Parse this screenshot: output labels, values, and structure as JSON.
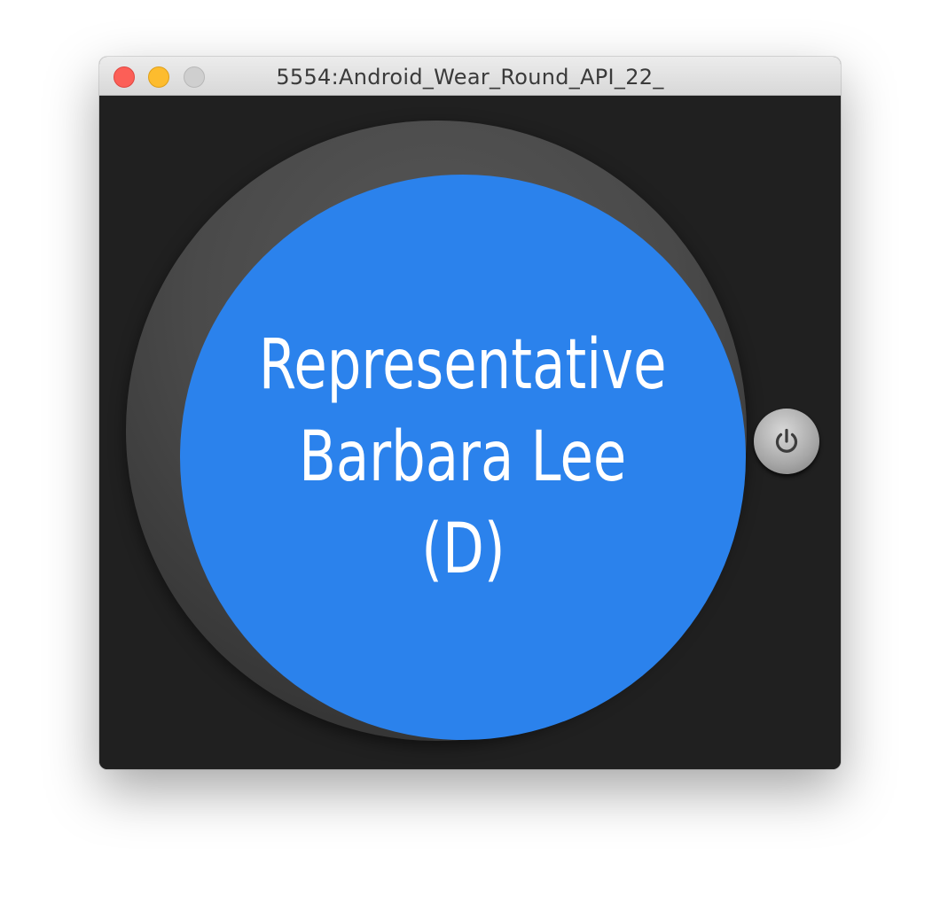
{
  "window": {
    "title": "5554:Android_Wear_Round_API_22_"
  },
  "watch": {
    "lines": [
      "Representative",
      "Barbara Lee",
      "(D)"
    ],
    "face_color": "#2b82ec",
    "text_color": "#ffffff"
  },
  "controls": {
    "power_icon": "power-icon"
  }
}
